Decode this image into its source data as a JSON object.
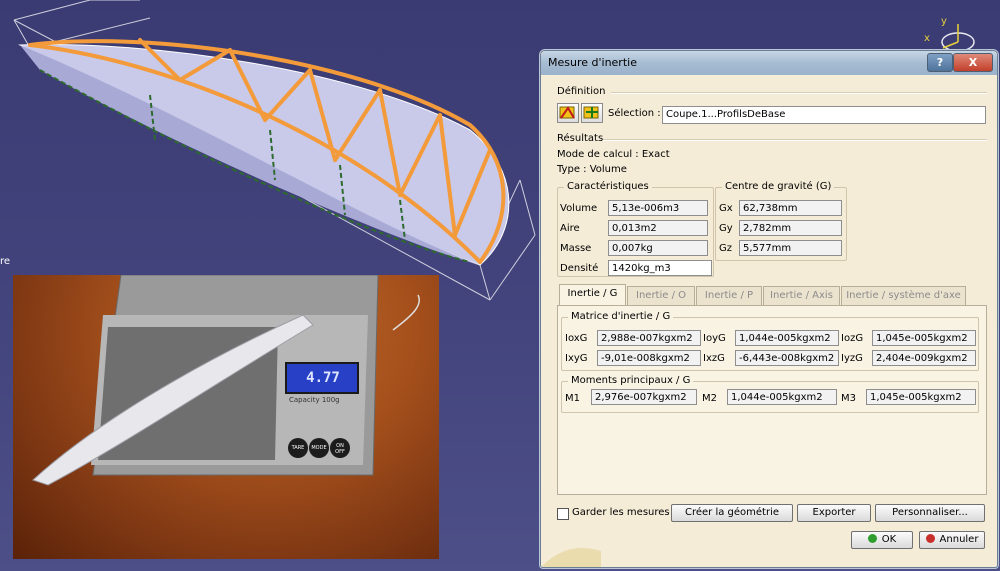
{
  "viewport": {
    "axis_x": "x",
    "axis_y": "y",
    "side_text": "re"
  },
  "scale_photo": {
    "display_reading": "4.77",
    "btn_tare": "TARE",
    "btn_mode": "MODE",
    "btn_onoff": "ON OFF",
    "capacity_text": "Capacity 100g"
  },
  "dialog": {
    "title": "Mesure d'inertie",
    "help_label": "?",
    "close_label": "X",
    "definition": {
      "label": "Définition",
      "selection_label": "Sélection :",
      "selection_value": "Coupe.1...ProfilsDeBase"
    },
    "results": {
      "label": "Résultats",
      "mode": "Mode de calcul : Exact",
      "type": "Type : Volume"
    },
    "caracteristiques": {
      "title": "Caractéristiques",
      "rows": [
        {
          "label": "Volume",
          "value": "5,13e-006m3"
        },
        {
          "label": "Aire",
          "value": "0,013m2"
        },
        {
          "label": "Masse",
          "value": "0,007kg"
        },
        {
          "label": "Densité",
          "value": "1420kg_m3"
        }
      ]
    },
    "centre": {
      "title": "Centre de gravité (G)",
      "rows": [
        {
          "label": "Gx",
          "value": "62,738mm"
        },
        {
          "label": "Gy",
          "value": "2,782mm"
        },
        {
          "label": "Gz",
          "value": "5,577mm"
        }
      ]
    },
    "tabs": [
      {
        "label": "Inertie / G",
        "active": true
      },
      {
        "label": "Inertie / O",
        "active": false
      },
      {
        "label": "Inertie / P",
        "active": false
      },
      {
        "label": "Inertie / Axis",
        "active": false
      },
      {
        "label": "Inertie / système d'axe",
        "active": false
      }
    ],
    "matrice": {
      "title": "Matrice d'inertie / G",
      "row1": [
        {
          "label": "IoxG",
          "value": "2,988e-007kgxm2"
        },
        {
          "label": "IoyG",
          "value": "1,044e-005kgxm2"
        },
        {
          "label": "IozG",
          "value": "1,045e-005kgxm2"
        }
      ],
      "row2": [
        {
          "label": "IxyG",
          "value": "-9,01e-008kgxm2"
        },
        {
          "label": "IxzG",
          "value": "-6,443e-008kgxm2"
        },
        {
          "label": "IyzG",
          "value": "2,404e-009kgxm2"
        }
      ]
    },
    "moments": {
      "title": "Moments principaux / G",
      "items": [
        {
          "label": "M1",
          "value": "2,976e-007kgxm2"
        },
        {
          "label": "M2",
          "value": "1,044e-005kgxm2"
        },
        {
          "label": "M3",
          "value": "1,045e-005kgxm2"
        }
      ]
    },
    "footer": {
      "keep_label": "Garder les mesures",
      "create_label": "Créer la géométrie",
      "export_label": "Exporter",
      "customize_label": "Personnaliser...",
      "ok_label": "OK",
      "cancel_label": "Annuler"
    },
    "colors": {
      "ok": "#2f9e2f",
      "cancel": "#c9302c"
    }
  }
}
